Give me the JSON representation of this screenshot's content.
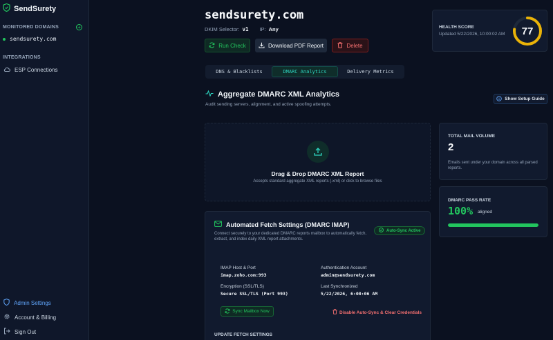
{
  "app": {
    "name": "SendSurety"
  },
  "sidebar": {
    "monitored_title": "MONITORED DOMAINS",
    "add_symbol": "+",
    "domains": [
      "sendsurety.com"
    ],
    "integrations_title": "INTEGRATIONS",
    "esp_label": "ESP Connections",
    "bottom": {
      "admin": "Admin Settings",
      "account": "Account & Billing",
      "signout": "Sign Out"
    }
  },
  "header": {
    "domain": "sendsurety.com",
    "dkim_label": "DKIM Selector:",
    "dkim_value": "v1",
    "ip_label": "IP:",
    "ip_value": "Any",
    "run_check": "Run Check",
    "download_pdf": "Download PDF Report",
    "delete": "Delete"
  },
  "health": {
    "label": "HEALTH SCORE",
    "updated": "Updated 5/22/2026, 10:00:02 AM",
    "score": "77",
    "score_fraction": 0.77,
    "color": "#eab308"
  },
  "tabs": [
    {
      "label": "DNS & Blacklists",
      "active": false
    },
    {
      "label": "DMARC Analytics",
      "active": true
    },
    {
      "label": "Delivery Metrics",
      "active": false
    }
  ],
  "section": {
    "title": "Aggregate DMARC XML Analytics",
    "subtitle": "Audit sending servers, alignment, and active spoofing attempts.",
    "guide_button": "Show Setup Guide"
  },
  "dropzone": {
    "title": "Drag & Drop DMARC XML Report",
    "subtitle": "Accepts standard aggregate XML reports (.xml) or click to browse files"
  },
  "stats": {
    "volume_label": "TOTAL MAIL VOLUME",
    "volume_value": "2",
    "volume_desc": "Emails sent under your domain across all parsed reports.",
    "pass_label": "DMARC PASS RATE",
    "pass_value": "100%",
    "pass_unit": "aligned",
    "pass_fraction": 1.0
  },
  "imap": {
    "title": "Automated Fetch Settings (DMARC IMAP)",
    "description": "Connect securely to your dedicated DMARC reports mailbox to automatically fetch, extract, and index daily XML report attachments.",
    "badge": "Auto-Sync Active",
    "host_label": "IMAP Host & Port",
    "host_value": "imap.zoho.com:993",
    "auth_label": "Authentication Account",
    "auth_value": "admin@sendsurety.com",
    "enc_label": "Encryption (SSL/TLS)",
    "enc_value": "Secure SSL/TLS (Port 993)",
    "last_label": "Last Synchronized",
    "last_value": "5/22/2026, 6:00:06 AM",
    "sync_button": "Sync Mailbox Now",
    "disable_button": "Disable Auto-Sync & Clear Credentials",
    "update_title": "UPDATE FETCH SETTINGS"
  }
}
